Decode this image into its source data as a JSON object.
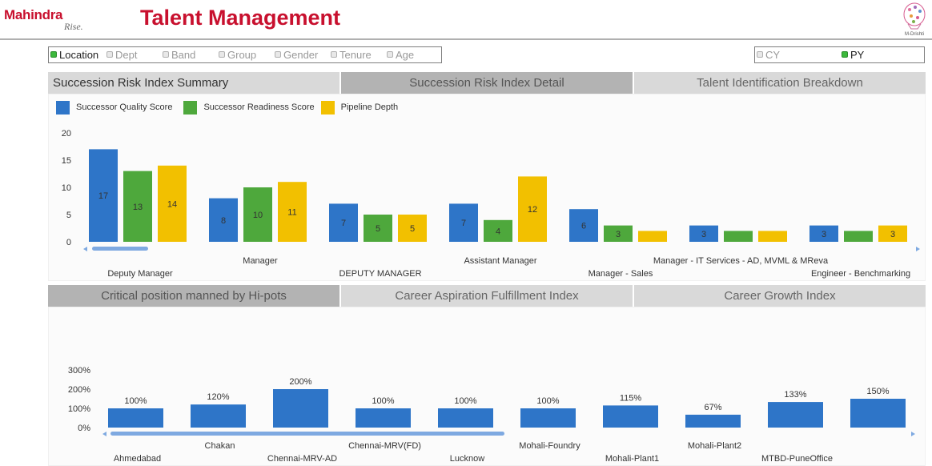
{
  "header": {
    "logo_text": "Mahindra",
    "logo_tagline": "Rise.",
    "title": "Talent Management",
    "brand_label": "M-Drishti"
  },
  "filters": {
    "dimensions": [
      {
        "label": "Location",
        "active": true
      },
      {
        "label": "Dept",
        "active": false
      },
      {
        "label": "Band",
        "active": false
      },
      {
        "label": "Group",
        "active": false
      },
      {
        "label": "Gender",
        "active": false
      },
      {
        "label": "Tenure",
        "active": false
      },
      {
        "label": "Age",
        "active": false
      }
    ],
    "periods": [
      {
        "label": "CY",
        "active": false
      },
      {
        "label": "PY",
        "active": true
      }
    ]
  },
  "top_tabs": [
    {
      "label": "Succession Risk Index Summary",
      "selected": false
    },
    {
      "label": "Succession Risk Index Detail",
      "selected": true
    },
    {
      "label": "Talent Identification Breakdown",
      "selected": false
    }
  ],
  "bottom_tabs": [
    {
      "label": "Critical position manned by Hi-pots",
      "selected": true
    },
    {
      "label": "Career Aspiration Fulfillment Index",
      "selected": false
    },
    {
      "label": "Career Growth Index",
      "selected": false
    }
  ],
  "colors": {
    "blue": "#2e75c8",
    "green": "#4ea83c",
    "yellow": "#f2c000",
    "accent_red": "#c8102e",
    "scrollbar": "#7ea9e1"
  },
  "chart_data": [
    {
      "type": "bar",
      "ylim": [
        0,
        20
      ],
      "yticks": [
        "0",
        "5",
        "10",
        "15",
        "20"
      ],
      "categories": [
        "Deputy Manager",
        "Manager",
        "DEPUTY MANAGER",
        "Assistant Manager",
        "Manager - Sales",
        "Manager - IT Services - AD, MVML & MReva",
        "Engineer - Benchmarking"
      ],
      "series": [
        {
          "name": "Successor Quality Score",
          "color": "#2e75c8",
          "values": [
            17,
            8,
            7,
            7,
            6,
            3,
            3
          ],
          "labels": [
            "17",
            "8",
            "7",
            "7",
            "6",
            "3",
            "3"
          ]
        },
        {
          "name": "Successor Readiness Score",
          "color": "#4ea83c",
          "values": [
            13,
            10,
            5,
            4,
            3,
            2,
            2
          ],
          "labels": [
            "13",
            "10",
            "5",
            "4",
            "3",
            "",
            ""
          ]
        },
        {
          "name": "Pipeline Depth",
          "color": "#f2c000",
          "values": [
            14,
            11,
            5,
            12,
            2,
            2,
            3
          ],
          "labels": [
            "14",
            "11",
            "5",
            "12",
            "",
            "",
            "3"
          ]
        }
      ],
      "legend": "top-left"
    },
    {
      "type": "bar",
      "ylim": [
        0,
        300
      ],
      "yticks": [
        "0%",
        "100%",
        "200%",
        "300%"
      ],
      "categories": [
        "Ahmedabad",
        "Chakan",
        "Chennai-MRV-AD",
        "Chennai-MRV(FD)",
        "Lucknow",
        "Mohali-Foundry",
        "Mohali-Plant1",
        "Mohali-Plant2",
        "MTBD-PuneOffice",
        ""
      ],
      "series": [
        {
          "color": "#2e75c8",
          "values": [
            100,
            120,
            200,
            100,
            100,
            100,
            115,
            67,
            133,
            150
          ],
          "labels": [
            "100%",
            "120%",
            "200%",
            "100%",
            "100%",
            "100%",
            "115%",
            "67%",
            "133%",
            "150%"
          ]
        }
      ]
    }
  ]
}
